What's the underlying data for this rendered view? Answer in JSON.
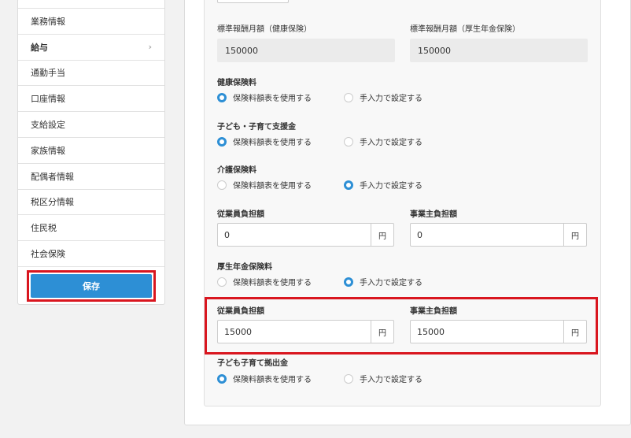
{
  "sidebar": {
    "items": [
      {
        "label": ""
      },
      {
        "label": "業務情報"
      },
      {
        "label": "給与",
        "chevron": "›"
      },
      {
        "label": "通勤手当"
      },
      {
        "label": "口座情報"
      },
      {
        "label": "支給設定"
      },
      {
        "label": "家族情報"
      },
      {
        "label": "配偶者情報"
      },
      {
        "label": "税区分情報"
      },
      {
        "label": "住民税"
      },
      {
        "label": "社会保険"
      }
    ],
    "save_label": "保存"
  },
  "form": {
    "std_health_label": "標準報酬月額（健康保険）",
    "std_health_value": "150000",
    "std_pension_label": "標準報酬月額（厚生年金保険）",
    "std_pension_value": "150000",
    "health_ins_label": "健康保険料",
    "child_support_label": "子ども・子育て支援金",
    "care_ins_label": "介護保険料",
    "pension_ins_label": "厚生年金保険料",
    "child_contrib_label": "子ども子育て拠出金",
    "opt_table": "保険料額表を使用する",
    "opt_manual": "手入力で設定する",
    "employee_label": "従業員負担額",
    "employer_label": "事業主負担額",
    "yen": "円",
    "care_employee_value": "0",
    "care_employer_value": "0",
    "pension_employee_value": "15000",
    "pension_employer_value": "15000"
  },
  "colors": {
    "accent": "#2d8fd5",
    "highlight": "#d9161f"
  }
}
